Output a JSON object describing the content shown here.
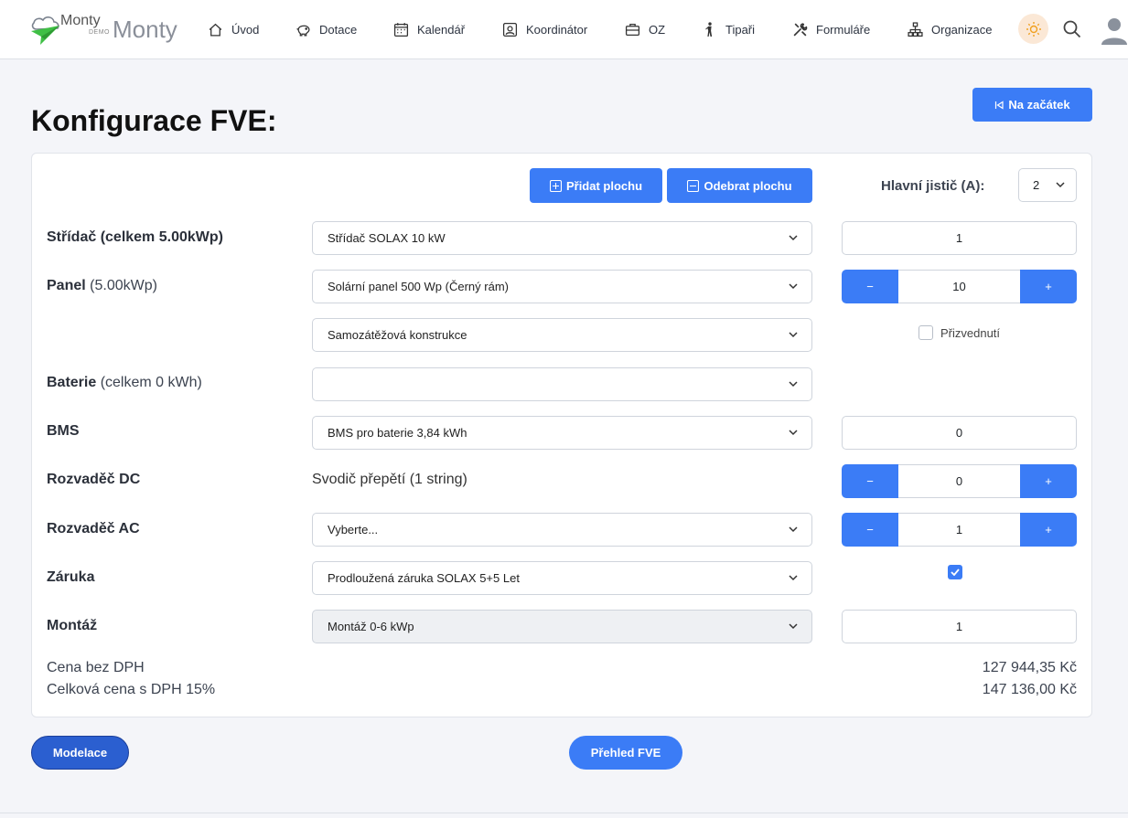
{
  "app": {
    "logo_small": "Monty",
    "logo_demo": "DEMO",
    "logo_big": "Monty",
    "accent_color": "#3b7cf6"
  },
  "nav": {
    "items": [
      {
        "label": "Úvod",
        "icon": "home-icon"
      },
      {
        "label": "Dotace",
        "icon": "piggy-bank-icon"
      },
      {
        "label": "Kalendář",
        "icon": "calendar-icon"
      },
      {
        "label": "Koordinátor",
        "icon": "person-badge-icon"
      },
      {
        "label": "OZ",
        "icon": "briefcase-icon"
      },
      {
        "label": "Tipaři",
        "icon": "person-walking-icon"
      },
      {
        "label": "Formuláře",
        "icon": "tools-icon"
      },
      {
        "label": "Organizace",
        "icon": "hierarchy-icon"
      }
    ]
  },
  "header": {
    "title": "Konfigurace FVE:",
    "start_button": "Na začátek"
  },
  "config": {
    "add_area": "Přidat plochu",
    "remove_area": "Odebrat plochu",
    "breaker_label": "Hlavní jistič (A):",
    "breaker_value": "2",
    "inverter": {
      "label": "Střídač (celkem 5.00kWp)",
      "select": "Střídač SOLAX 10 kW",
      "qty": "1"
    },
    "panel": {
      "label": "Panel",
      "label_extra": "(5.00kWp)",
      "select": "Solární panel 500 Wp (Černý rám)",
      "qty": "10",
      "minus": "−",
      "plus": "+"
    },
    "construction": {
      "select": "Samozátěžová konstrukce",
      "lift_label": "Přizvednutí",
      "lift_checked": false
    },
    "battery": {
      "label": "Baterie",
      "label_extra": "(celkem 0 kWh)",
      "select": ""
    },
    "bms": {
      "label": "BMS",
      "select": "BMS pro baterie 3,84 kWh",
      "qty": "0"
    },
    "dc": {
      "label": "Rozvaděč DC",
      "text": "Svodič přepětí (1 string)",
      "qty": "0",
      "minus": "−",
      "plus": "+"
    },
    "ac": {
      "label": "Rozvaděč AC",
      "select": "Vyberte...",
      "qty": "1",
      "minus": "−",
      "plus": "+"
    },
    "warranty": {
      "label": "Záruka",
      "select": "Prodloužená záruka SOLAX 5+5 Let",
      "checked": true
    },
    "install": {
      "label": "Montáž",
      "select": "Montáž 0-6 kWp",
      "qty": "1"
    },
    "price_net_label": "Cena bez DPH",
    "price_net": "127 944,35 Kč",
    "price_gross_label": "Celková cena s DPH 15%",
    "price_gross": "147 136,00 Kč"
  },
  "footer": {
    "model_button": "Modelace",
    "overview_button": "Přehled FVE"
  }
}
